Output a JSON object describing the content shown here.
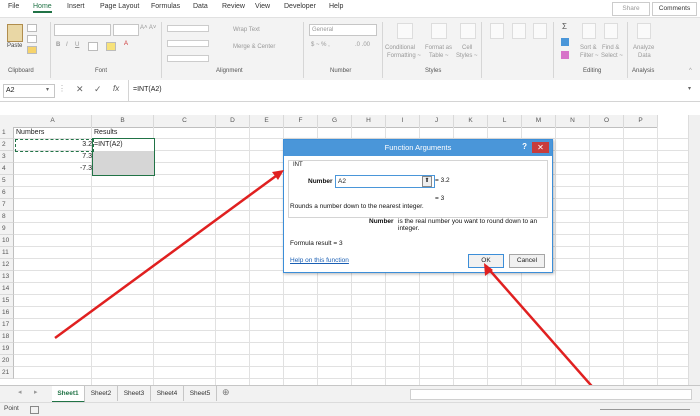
{
  "ribbon_tabs": [
    "File",
    "Home",
    "Insert",
    "Page Layout",
    "Formulas",
    "Data",
    "Review",
    "View",
    "Developer",
    "Help"
  ],
  "share_label": "Share",
  "comments_label": "Comments",
  "clipboard": {
    "paste": "Paste",
    "group": "Clipboard"
  },
  "font": {
    "group": "Font"
  },
  "alignment": {
    "wrap": "Wrap Text",
    "merge": "Merge & Center",
    "group": "Alignment"
  },
  "number": {
    "format": "General",
    "group": "Number"
  },
  "styles": {
    "conditional": "Conditional",
    "formatting": "Formatting ~",
    "format_as": "Format as",
    "table": "Table ~",
    "cell": "Cell",
    "cell_styles": "Styles ~",
    "group": "Styles"
  },
  "cells": {
    "a1": "Numbers",
    "b1": "Results",
    "a2": "3.2",
    "b2": "=INT(A2)",
    "a3": "7.3",
    "a4": "-7.3"
  },
  "editing": {
    "sort": "Sort &",
    "filter": "Filter ~",
    "find": "Find &",
    "select": "Select ~",
    "group": "Editing"
  },
  "analysis": {
    "analyze": "Analyze",
    "data": "Data",
    "group": "Analysis"
  },
  "formula_bar": {
    "name_box": "A2",
    "formula": "=INT(A2)",
    "fx": "fx"
  },
  "columns": [
    "A",
    "B",
    "C",
    "D",
    "E",
    "F",
    "G",
    "H",
    "I",
    "J",
    "K",
    "L",
    "M",
    "N",
    "O",
    "P",
    "Q"
  ],
  "rows": [
    "1",
    "2",
    "3",
    "4",
    "5",
    "6",
    "7",
    "8",
    "9",
    "10",
    "11",
    "12",
    "13",
    "14",
    "15",
    "16",
    "17",
    "18",
    "19",
    "20",
    "21",
    "22"
  ],
  "dialog": {
    "title": "Function Arguments",
    "help_glyph": "?",
    "close_glyph": "✕",
    "func_name": "INT",
    "arg_label": "Number",
    "arg_value": "A2",
    "arg_result": "= 3.2",
    "result_eq": "= 3",
    "description": "Rounds a number down to the nearest integer.",
    "arg_desc_bold": "Number",
    "arg_desc": "is the real number you want to round down to an integer.",
    "formula_result": "Formula result = 3",
    "help_link": "Help on this function",
    "ok": "OK",
    "cancel": "Cancel"
  },
  "sheets": [
    "Sheet1",
    "Sheet2",
    "Sheet3",
    "Sheet4",
    "Sheet5"
  ],
  "status": {
    "mode": "Point"
  },
  "colors": {
    "excel_green": "#217346",
    "dialog_blue": "#4a96d9",
    "arrow_red": "#e02020"
  }
}
